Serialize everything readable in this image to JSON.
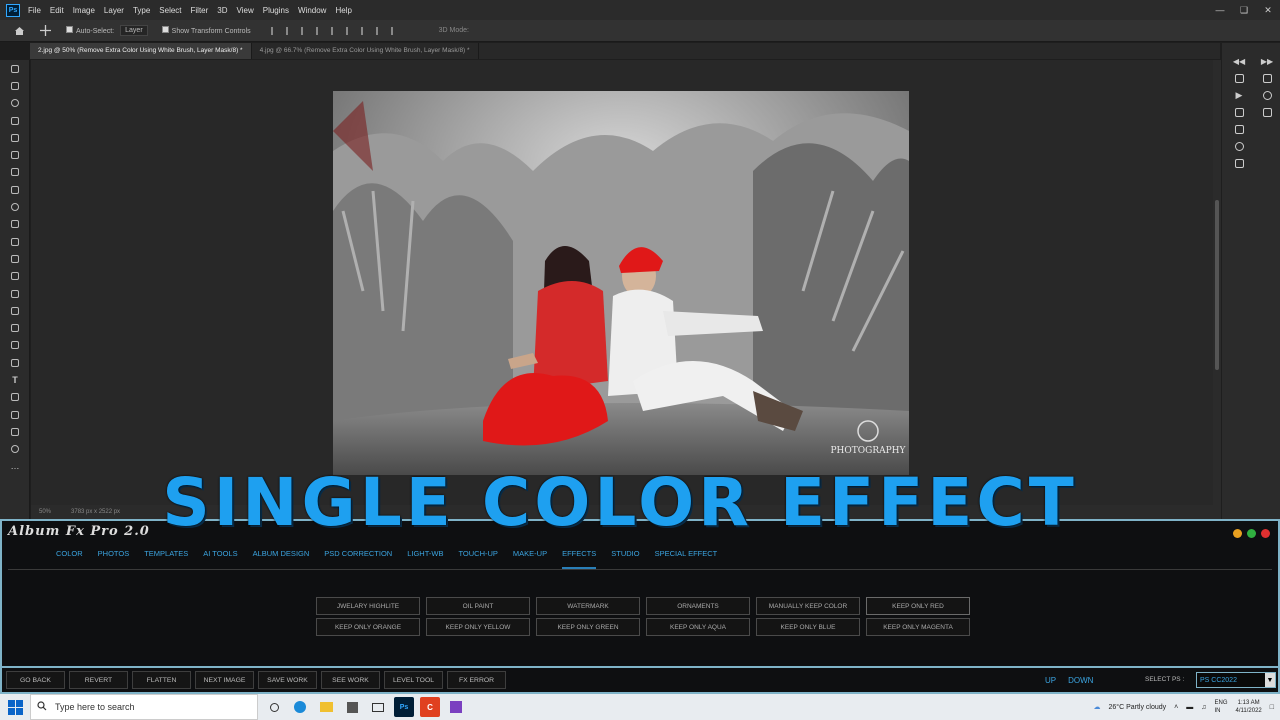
{
  "menubar": {
    "items": [
      "File",
      "Edit",
      "Image",
      "Layer",
      "Type",
      "Select",
      "Filter",
      "3D",
      "View",
      "Plugins",
      "Window",
      "Help"
    ]
  },
  "optbar": {
    "auto_select": "Auto-Select:",
    "layer_select": "Layer",
    "show_transform": "Show Transform Controls",
    "mode_3d": "3D Mode:"
  },
  "tabs": [
    "2.jpg @ 50% (Remove Extra Color Using White Brush, Layer Mask/8) *",
    "4.jpg @ 66.7% (Remove Extra Color Using White Brush, Layer Mask/8) *"
  ],
  "status": {
    "zoom": "50%",
    "doc": "3783 px x 2522 px"
  },
  "photo": {
    "watermark": "PHOTOGRAPHY"
  },
  "overlay_title": "SINGLE COLOR EFFECT",
  "albumfx": {
    "title": "Album Fx Pro 2.0",
    "nav": [
      "COLOR",
      "PHOTOS",
      "TEMPLATES",
      "AI TOOLS",
      "ALBUM DESIGN",
      "PSD CORRECTION",
      "LIGHT-WB",
      "TOUCH-UP",
      "MAKE-UP",
      "EFFECTS",
      "STUDIO",
      "SPECIAL EFFECT"
    ],
    "active_nav": "EFFECTS",
    "buttons": [
      "JWELARY HIGHLITE",
      "OIL PAINT",
      "WATERMARK",
      "ORNAMENTS",
      "MANUALLY KEEP COLOR",
      "KEEP ONLY RED",
      "KEEP ONLY ORANGE",
      "KEEP ONLY YELLOW",
      "KEEP ONLY GREEN",
      "KEEP ONLY AQUA",
      "KEEP ONLY BLUE",
      "KEEP ONLY MAGENTA"
    ],
    "bottom": [
      "GO BACK",
      "REVERT",
      "FLATTEN",
      "NEXT IMAGE",
      "SAVE WORK",
      "SEE WORK",
      "LEVEL TOOL",
      "FX ERROR"
    ],
    "up": "UP",
    "down": "DOWN",
    "select_ps_label": "SELECT PS :",
    "select_ps_value": "PS CC2022"
  },
  "taskbar": {
    "search_placeholder": "Type here to search",
    "weather": "26°C  Partly cloudy",
    "lang": "ENG\nIN",
    "time": "1:13 AM",
    "date": "4/11/2022"
  },
  "colors": {
    "accent": "#1ea0f0",
    "panel_border": "#7fb3c8",
    "nav_text": "#3ba4e0"
  }
}
